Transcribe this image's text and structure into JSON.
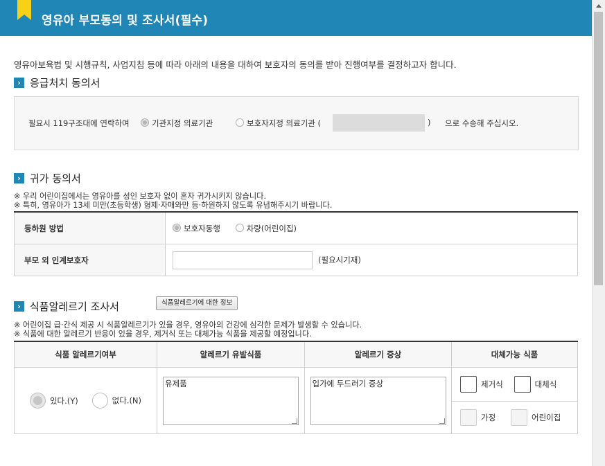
{
  "header": {
    "title": "영유아 부모동의 및 조사서(필수)"
  },
  "intro": "영유아보육법 및 시행규칙, 사업지침 등에 따라 아래의 내용을 대하여 보호자의 동의를 받아 진행여부를 결정하고자 합니다.",
  "emergency": {
    "title": "응급처치 동의서",
    "prefix": "필요시 119구조대에 연락하여",
    "option1": "기관지정 의료기관",
    "option2": "보호자지정 의료기관 (",
    "close_paren": ")",
    "suffix": "으로 수송해 주십시오."
  },
  "return_home": {
    "title": "귀가 동의서",
    "note1": "※ 우리 어린이집에서는 영유아를 성인 보호자 없이 혼자 귀가시키지 않습니다.",
    "note2": "※ 특히, 영유아가 13세 미만(초등학생) 형제·자매와만 등·하원하지 않도록 유념해주시기 바랍니다.",
    "row1_label": "등하원 방법",
    "row1_opt1": "보호자동행",
    "row1_opt2": "차량(어린이집)",
    "row2_label": "부모 외 인계보호자",
    "row2_hint": "(필요시기재)"
  },
  "allergy": {
    "title": "식품알레르기 조사서",
    "info_button": "식품알레르기에 대한 정보",
    "note1": "※ 어린이집 급·간식 제공 시 식품알레르기가 있을 경우, 영유아의 건강에 심각한 문제가 발생할 수 있습니다.",
    "note2": "※ 식품에 대한 알레르기 반응이 있을 경우, 제거식 또는 대체가능 식품을 제공할 예정입니다.",
    "col_headers": [
      "식품 알레르기여부",
      "알레르기 유발식품",
      "알레르기 증상",
      "대체가능 식품"
    ],
    "yes_label": "있다.(Y)",
    "no_label": "없다.(N)",
    "trigger_food": "유제품",
    "symptom": "입가에 두드러기 증상",
    "alt_options": [
      "제거식",
      "대체식",
      "가정",
      "어린이집"
    ]
  }
}
